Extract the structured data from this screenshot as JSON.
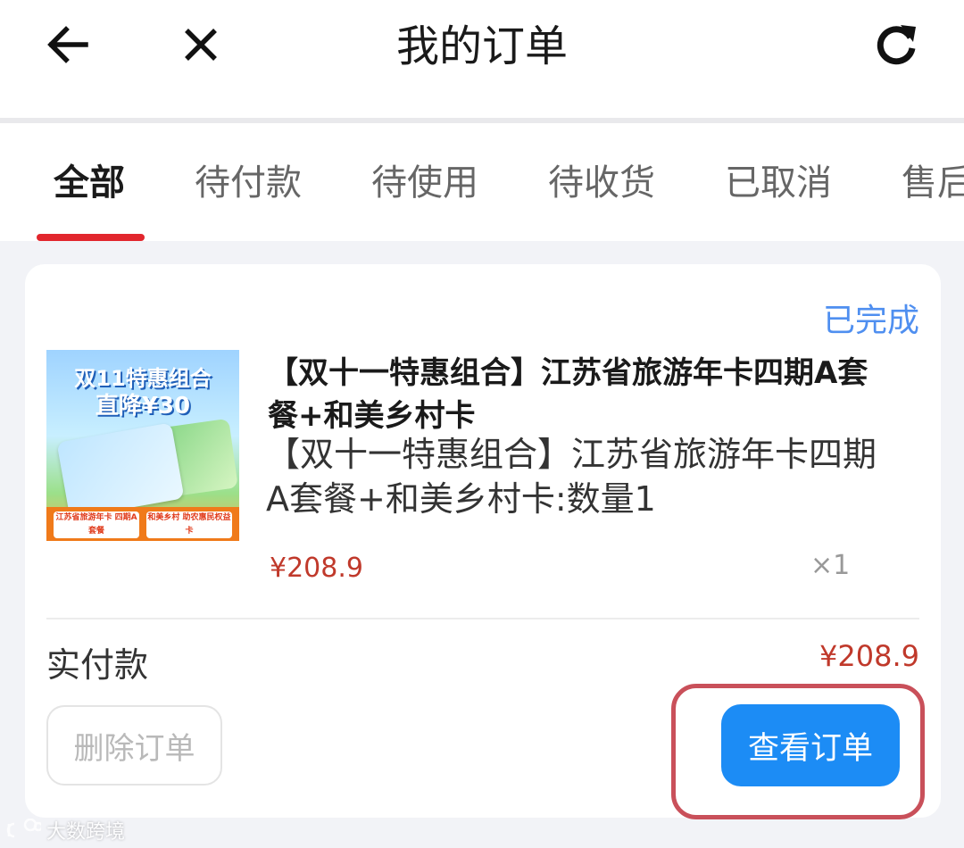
{
  "header": {
    "title": "我的订单",
    "back_icon": "arrow-left-icon",
    "close_icon": "close-icon",
    "refresh_icon": "refresh-icon"
  },
  "tabs": [
    {
      "label": "全部",
      "active": true
    },
    {
      "label": "待付款"
    },
    {
      "label": "待使用"
    },
    {
      "label": "待收货"
    },
    {
      "label": "已取消"
    },
    {
      "label": "售后"
    }
  ],
  "order": {
    "status": "已完成",
    "product": {
      "image_text": {
        "line1": "双11特惠组合",
        "line2": "直降¥30",
        "left_label": "江苏省旅游年卡 四期A套餐",
        "right_label": "和美乡村 助农惠民权益卡"
      },
      "title": "【双十一特惠组合】江苏省旅游年卡四期A套餐+和美乡村卡",
      "description": "【双十一特惠组合】江苏省旅游年卡四期A套餐+和美乡村卡:数量1",
      "price": "¥208.9",
      "quantity": "×1"
    },
    "paid_label": "实付款",
    "paid_amount": "¥208.9",
    "actions": {
      "delete_label": "删除订单",
      "view_label": "查看订单"
    }
  },
  "watermark": "大数跨境",
  "colors": {
    "accent_red": "#e2262d",
    "status_blue": "#4f8ff0",
    "price_red": "#c0392b",
    "button_blue": "#1c8cf5",
    "highlight_border": "#c9505a"
  }
}
